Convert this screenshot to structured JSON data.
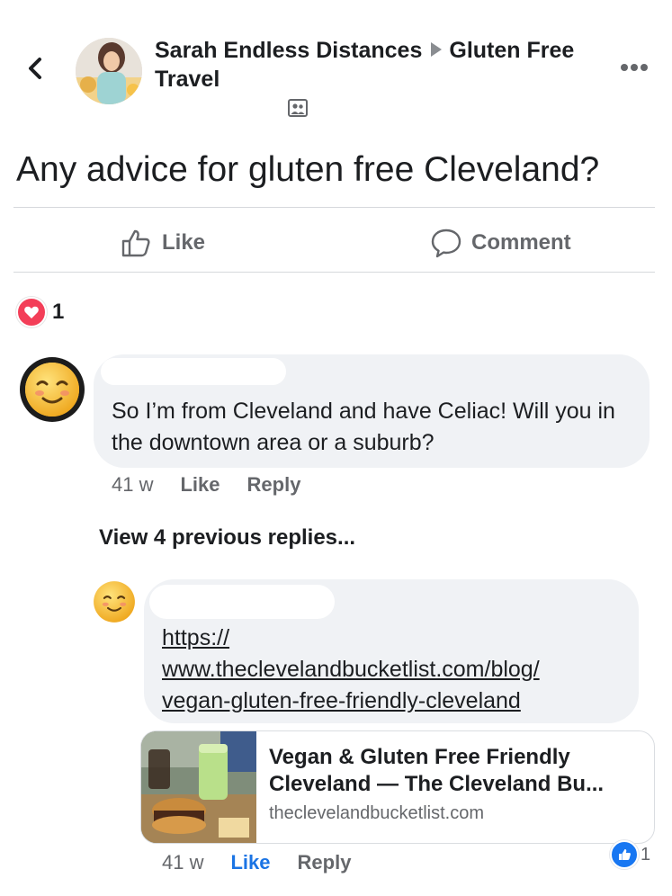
{
  "header": {
    "author": "Sarah Endless Distances",
    "group": "Gluten Free Travel",
    "more_icon": "more-horizontal-icon",
    "back_icon": "chevron-left-icon"
  },
  "post": {
    "text": "Any advice for gluten free Cleveland?",
    "actions": {
      "like": "Like",
      "comment": "Comment"
    },
    "reactions": {
      "type": "heart",
      "count": "1"
    }
  },
  "comments": [
    {
      "text": "So I’m from Cleveland and have Celiac!  Will you in the downtown area or a suburb?",
      "time": "41 w",
      "like": "Like",
      "reply": "Reply"
    }
  ],
  "view_replies": "View 4 previous replies...",
  "reply": {
    "link_lines": [
      "https://",
      "www.theclevelandbucketlist.com/blog/",
      "vegan-gluten-free-friendly-cleveland"
    ],
    "card": {
      "title_line1": "Vegan & Gluten Free Friendly",
      "title_line2": "Cleveland — The Cleveland Bu...",
      "domain": "theclevelandbucketlist.com"
    },
    "time": "41 w",
    "like": "Like",
    "reply": "Reply",
    "like_count": "1"
  },
  "colors": {
    "accent": "#1b74e4",
    "heart": "#f33e58",
    "bubble": "#f0f2f5"
  }
}
